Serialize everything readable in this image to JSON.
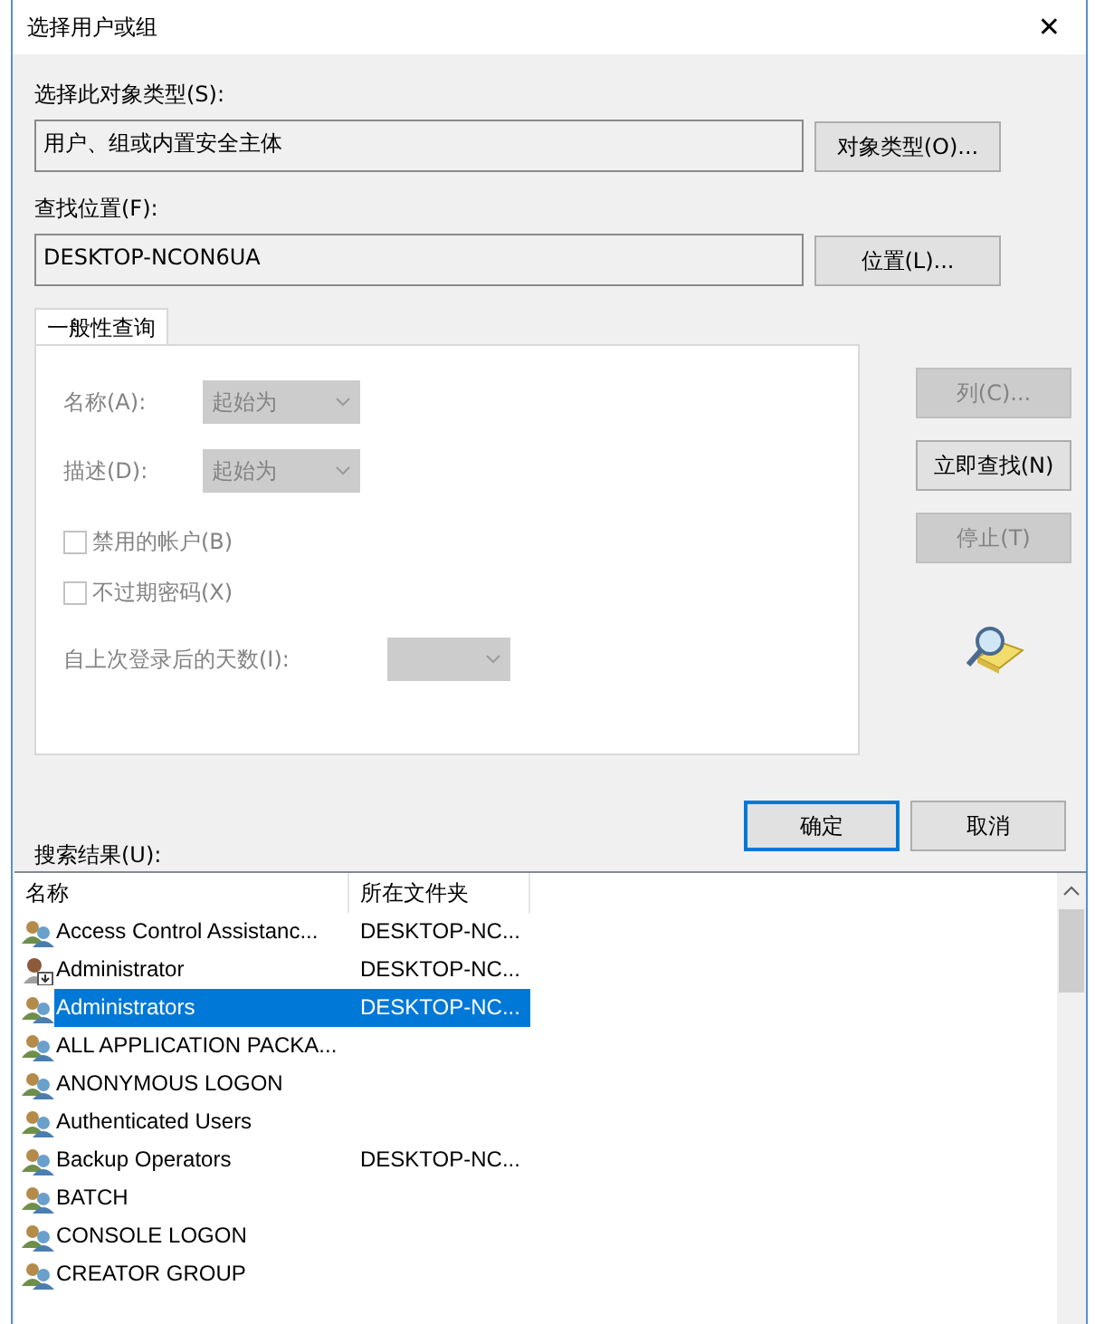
{
  "window": {
    "title": "选择用户或组",
    "close": "✕"
  },
  "object_type": {
    "label": "选择此对象类型(S):",
    "value": "用户、组或内置安全主体",
    "button": "对象类型(O)..."
  },
  "location": {
    "label": "查找位置(F):",
    "value": "DESKTOP-NCON6UA",
    "button": "位置(L)..."
  },
  "tabs": [
    {
      "label": "一般性查询",
      "selected": true
    }
  ],
  "query": {
    "fields": [
      {
        "label": "名称(A):",
        "value": "起始为",
        "disabled": true
      },
      {
        "label": "描述(D):",
        "value": "起始为",
        "disabled": true
      }
    ],
    "checkboxes": [
      {
        "label": "禁用的帐户(B)",
        "checked": false,
        "disabled": true
      },
      {
        "label": "不过期密码(X)",
        "checked": false,
        "disabled": true
      }
    ],
    "days": {
      "label": "自上次登录后的天数(I):",
      "disabled": true
    }
  },
  "side_buttons": [
    {
      "label": "列(C)...",
      "disabled": true
    },
    {
      "label": "立即查找(N)",
      "disabled": false
    },
    {
      "label": "停止(T)",
      "disabled": true
    }
  ],
  "ok_button": "确定",
  "cancel_button": "取消",
  "results": {
    "label": "搜索结果(U):",
    "columns": [
      "名称",
      "所在文件夹"
    ],
    "rows": [
      {
        "kind": "group",
        "name": "Access Control Assistanc...",
        "folder": "DESKTOP-NC...",
        "selected": false
      },
      {
        "kind": "user",
        "name": "Administrator",
        "folder": "DESKTOP-NC...",
        "selected": false
      },
      {
        "kind": "group",
        "name": "Administrators",
        "folder": "DESKTOP-NC...",
        "selected": true
      },
      {
        "kind": "group",
        "name": "ALL APPLICATION PACKA...",
        "selected": false
      },
      {
        "kind": "group",
        "name": "ANONYMOUS LOGON",
        "selected": false
      },
      {
        "kind": "group",
        "name": "Authenticated Users",
        "selected": false
      },
      {
        "kind": "group",
        "name": "Backup Operators",
        "folder": "DESKTOP-NC...",
        "selected": false
      },
      {
        "kind": "group",
        "name": "BATCH",
        "selected": false
      },
      {
        "kind": "group",
        "name": "CONSOLE LOGON",
        "selected": false
      },
      {
        "kind": "group",
        "name": "CREATOR GROUP",
        "selected": false
      }
    ]
  }
}
